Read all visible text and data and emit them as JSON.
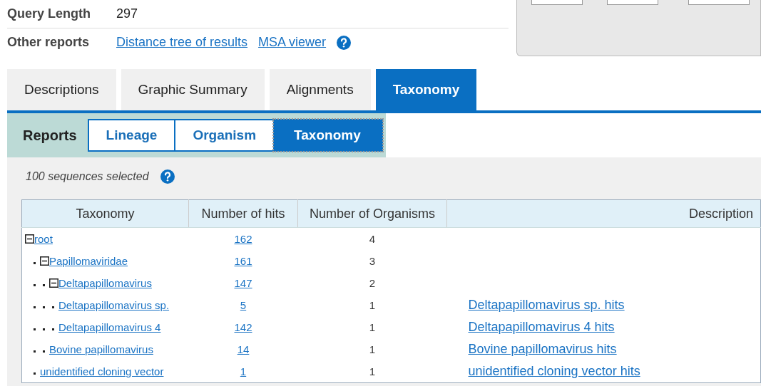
{
  "summary": [
    {
      "label": "Query Length",
      "value": "297"
    }
  ],
  "other_reports": {
    "label": "Other reports",
    "links": [
      "Distance tree of results",
      "MSA viewer"
    ]
  },
  "tabs": [
    {
      "label": "Descriptions",
      "selected": false
    },
    {
      "label": "Graphic Summary",
      "selected": false
    },
    {
      "label": "Alignments",
      "selected": false
    },
    {
      "label": "Taxonomy",
      "selected": true
    }
  ],
  "reports": {
    "label": "Reports",
    "buttons": [
      {
        "label": "Lineage",
        "selected": false
      },
      {
        "label": "Organism",
        "selected": false
      },
      {
        "label": "Taxonomy",
        "selected": true
      }
    ]
  },
  "selection_note": "100 sequences selected",
  "table": {
    "columns": [
      "Taxonomy",
      "Number of hits",
      "Number of Organisms",
      "Description"
    ],
    "tree": [
      {
        "name": "root",
        "hits": "162",
        "organisms": "4",
        "expanded": true,
        "children": [
          {
            "name": "Papillomaviridae",
            "hits": "161",
            "organisms": "3",
            "expanded": true,
            "children": [
              {
                "name": "Deltapapillomavirus",
                "hits": "147",
                "organisms": "2",
                "expanded": true,
                "children": [
                  {
                    "name": "Deltapapillomavirus sp.",
                    "hits": "5",
                    "organisms": "1",
                    "description": "Deltapapillomavirus sp. hits"
                  },
                  {
                    "name": "Deltapapillomavirus 4",
                    "hits": "142",
                    "organisms": "1",
                    "description": "Deltapapillomavirus 4 hits"
                  }
                ]
              },
              {
                "name": "Bovine papillomavirus",
                "hits": "14",
                "organisms": "1",
                "description": "Bovine papillomavirus hits"
              }
            ]
          },
          {
            "name": "unidentified cloning vector",
            "hits": "1",
            "organisms": "1",
            "description": "unidentified cloning vector hits"
          }
        ]
      }
    ]
  }
}
